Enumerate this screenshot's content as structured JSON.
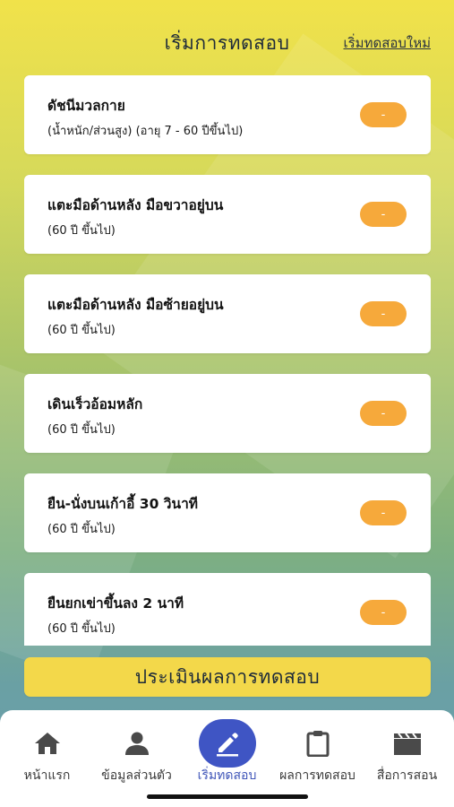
{
  "header": {
    "title": "เริ่มการทดสอบ",
    "restart_link": "เริ่มทดสอบใหม่"
  },
  "tests": [
    {
      "title": "ดัชนีมวลกาย",
      "subtitle": "(น้ำหนัก/ส่วนสูง) (อายุ 7 - 60 ปีขึ้นไป)",
      "result": "-"
    },
    {
      "title": "แตะมือด้านหลัง มือขวาอยู่บน",
      "subtitle": "(60 ปี ขึ้นไป)",
      "result": "-"
    },
    {
      "title": "แตะมือด้านหลัง มือซ้ายอยู่บน",
      "subtitle": "(60 ปี ขึ้นไป)",
      "result": "-"
    },
    {
      "title": "เดินเร็วอ้อมหลัก",
      "subtitle": "(60 ปี ขึ้นไป)",
      "result": "-"
    },
    {
      "title": "ยืน-นั่งบนเก้าอี้ 30 วินาที",
      "subtitle": "(60 ปี ขึ้นไป)",
      "result": "-"
    },
    {
      "title": "ยืนยกเข่าขึ้นลง 2 นาที",
      "subtitle": "(60 ปี ขึ้นไป)",
      "result": "-"
    }
  ],
  "evaluate_button": "ประเมินผลการทดสอบ",
  "tabbar": {
    "items": [
      {
        "label": "หน้าแรก",
        "icon": "home-icon"
      },
      {
        "label": "ข้อมูลส่วนตัว",
        "icon": "person-icon"
      },
      {
        "label": "เริ่มทดสอบ",
        "icon": "pencil-icon",
        "active": true
      },
      {
        "label": "ผลการทดสอบ",
        "icon": "clipboard-icon"
      },
      {
        "label": "สื่อการสอน",
        "icon": "clapperboard-icon"
      }
    ]
  },
  "colors": {
    "badge": "#f6a93b",
    "evaluate_button": "#f3d84a",
    "active_tab": "#3f55c4"
  }
}
